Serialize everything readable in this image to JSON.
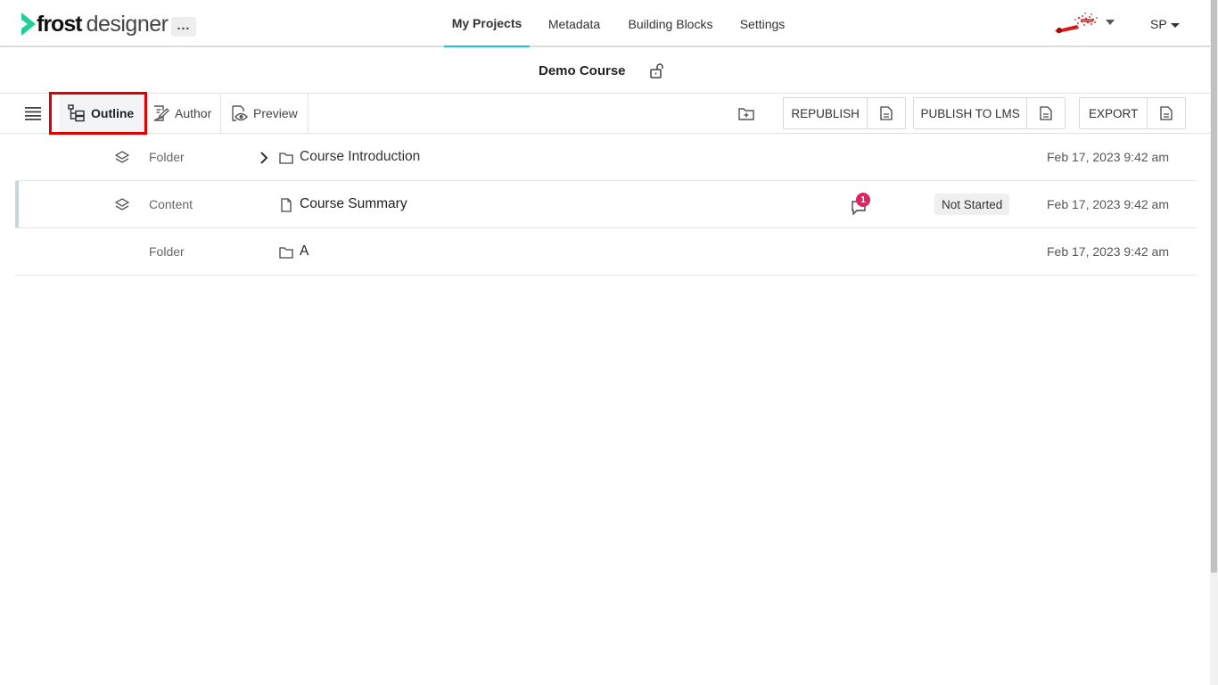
{
  "brand": {
    "bold": "frost",
    "light": "designer",
    "accent_color": "#1fcf95"
  },
  "topnav": {
    "more_label": "...",
    "items": [
      {
        "label": "My Projects",
        "active": true
      },
      {
        "label": "Metadata",
        "active": false
      },
      {
        "label": "Building Blocks",
        "active": false
      },
      {
        "label": "Settings",
        "active": false
      }
    ],
    "user_initials": "SP",
    "active_color": "#18c5d6"
  },
  "course": {
    "title": "Demo Course"
  },
  "toolbar": {
    "tabs": [
      {
        "label": "Outline",
        "active": true,
        "icon": "outline-tree-icon"
      },
      {
        "label": "Author",
        "active": false,
        "icon": "author-edit-icon"
      },
      {
        "label": "Preview",
        "active": false,
        "icon": "preview-eye-icon"
      }
    ],
    "buttons": {
      "republish": "REPUBLISH",
      "publish_lms": "PUBLISH TO LMS",
      "export": "EXPORT"
    }
  },
  "rows": [
    {
      "type": "Folder",
      "name": "Course Introduction",
      "icon": "folder-icon",
      "expandable": true,
      "date": "Feb 17, 2023 9:42 am"
    },
    {
      "type": "Content",
      "name": "Course Summary",
      "icon": "document-icon",
      "comment_count": "1",
      "status": "Not Started",
      "date": "Feb 17, 2023 9:42 am"
    },
    {
      "type": "Folder",
      "name": "A",
      "icon": "folder-icon",
      "date": "Feb 17, 2023 9:42 am"
    }
  ],
  "highlight_color": "#e00000"
}
